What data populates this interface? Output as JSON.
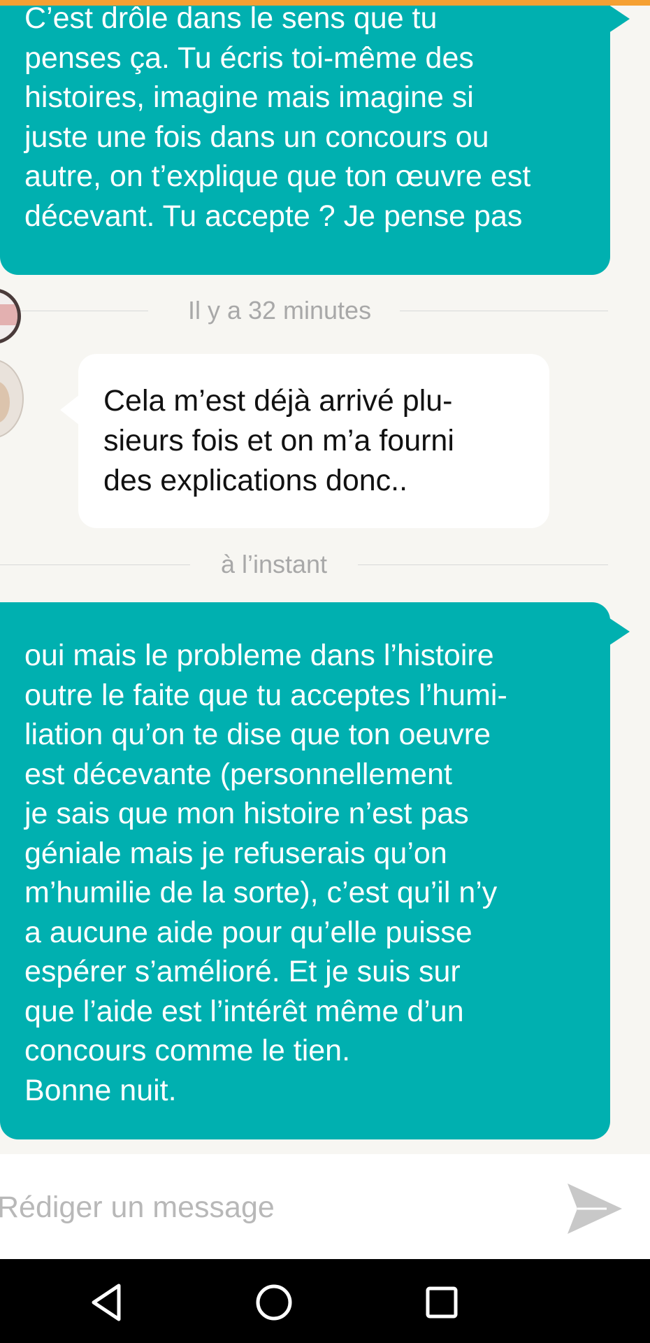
{
  "conversation": {
    "messages": [
      {
        "direction": "outgoing",
        "text": "C’est drôle dans le sens que tu\npenses ça. Tu écris toi-même des\nhistoires, imagine mais imagine si\njuste une fois dans un concours ou\nautre, on t’explique que ton œuvre est\ndécevant. Tu accepte ? Je pense pas"
      },
      {
        "direction": "incoming",
        "timestamp": "Il y a 32 minutes",
        "text": "Cela m’est déjà arrivé plu-\nsieurs fois et on m’a fourni\ndes explications donc.."
      },
      {
        "direction": "outgoing",
        "timestamp": "à l’instant",
        "text": "oui mais le probleme dans l’histoire\noutre le faite que tu acceptes l’humi-\nliation qu’on te dise que ton oeuvre\nest décevante (personnellement\nje sais que mon histoire n’est pas\ngéniale mais je refuserais qu’on\nm’humilie de la sorte), c’est qu’il n’y\na aucune aide pour qu’elle puisse\nespérer s’amélioré. Et je suis sur\nque l’aide est l’intérêt même d’un\nconcours comme le tien.\nBonne nuit."
      }
    ]
  },
  "composer": {
    "placeholder": "Rédiger un message",
    "value": "",
    "send_icon": "send-icon"
  },
  "system_nav": {
    "back_icon": "back-triangle-icon",
    "home_icon": "home-circle-icon",
    "recents_icon": "recents-square-icon"
  },
  "colors": {
    "accent_bar": "#f5a033",
    "outgoing_bubble": "#00b0b0",
    "incoming_bubble": "#ffffff",
    "background": "#f7f6f2",
    "timestamp_text": "#a8a8a8",
    "placeholder_text": "#b8b8b8",
    "send_icon": "#c8c8c8",
    "nav_bar": "#000000"
  }
}
